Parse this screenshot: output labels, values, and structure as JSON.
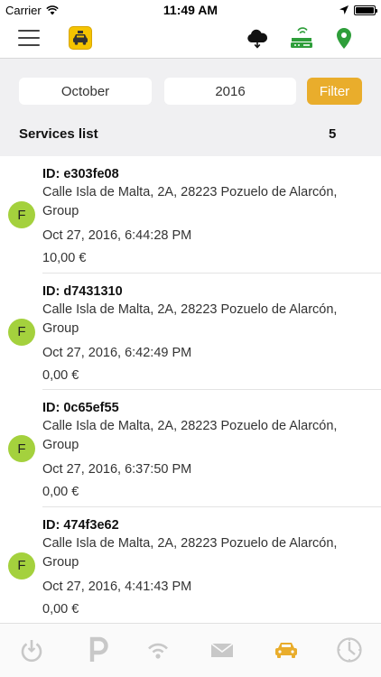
{
  "status_bar": {
    "carrier": "Carrier",
    "time": "11:49 AM"
  },
  "filter": {
    "month": "October",
    "year": "2016",
    "button_label": "Filter"
  },
  "list": {
    "title": "Services list",
    "count": "5"
  },
  "services": [
    {
      "avatar": "F",
      "id": "ID: e303fe08",
      "address": "Calle Isla de Malta, 2A, 28223 Pozuelo de Alarcón,",
      "group": "Group",
      "date": "Oct 27, 2016, 6:44:28 PM",
      "price": "10,00 €"
    },
    {
      "avatar": "F",
      "id": "ID: d7431310",
      "address": "Calle Isla de Malta, 2A, 28223 Pozuelo de Alarcón,",
      "group": "Group",
      "date": "Oct 27, 2016, 6:42:49 PM",
      "price": "0,00 €"
    },
    {
      "avatar": "F",
      "id": "ID: 0c65ef55",
      "address": "Calle Isla de Malta, 2A, 28223 Pozuelo de Alarcón,",
      "group": "Group",
      "date": "Oct 27, 2016, 6:37:50 PM",
      "price": "0,00 €"
    },
    {
      "avatar": "F",
      "id": "ID: 474f3e62",
      "address": "Calle Isla de Malta, 2A, 28223 Pozuelo de Alarcón,",
      "group": "Group",
      "date": "Oct 27, 2016, 4:41:43 PM",
      "price": "0,00 €"
    }
  ],
  "colors": {
    "accent": "#e9ad2c",
    "avatar": "#a4d13d",
    "nav_green": "#2e9e3a",
    "tab_inactive": "#c8c8c8"
  },
  "icons": {
    "nav": [
      "menu-icon",
      "taxi-logo-icon",
      "cloud-download-icon",
      "router-icon",
      "map-pin-icon"
    ],
    "tabs": [
      "power-icon",
      "parking-icon",
      "wifi-signal-icon",
      "mail-icon",
      "car-icon",
      "clock-icon"
    ]
  }
}
